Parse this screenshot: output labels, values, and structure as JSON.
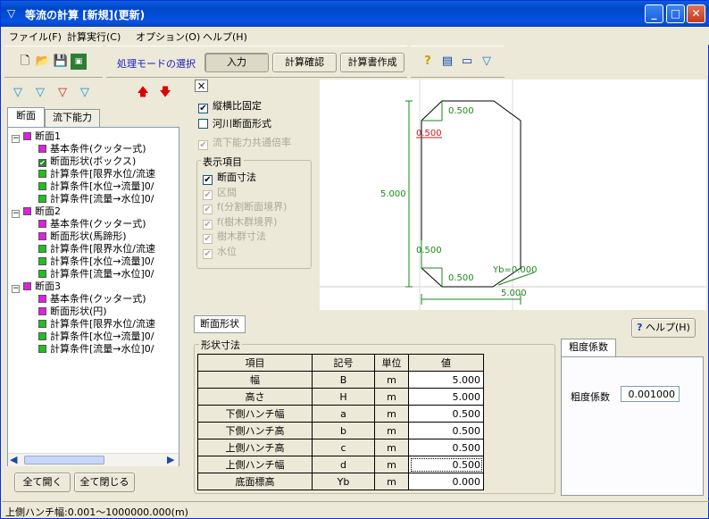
{
  "title": "等流の計算 [新規](更新)",
  "menu": [
    "ファイル(F)",
    "計算実行(C)",
    "オプション(O)",
    "ヘルプ(H)"
  ],
  "toolbar": {
    "mode_label": "処理モードの選択",
    "input": "入力",
    "confirm": "計算確認",
    "report": "計算書作成"
  },
  "left_tabs": [
    "断面",
    "流下能力"
  ],
  "tree": [
    {
      "label": "断面1",
      "children": [
        {
          "label": "基本条件(クッター式)",
          "color": "#e020e0"
        },
        {
          "label": "断面形状(ボックス)",
          "color": "#2a8a2a",
          "checked": true
        },
        {
          "label": "計算条件[限界水位/流速",
          "color": "#20c020"
        },
        {
          "label": "計算条件[水位→流量]0/",
          "color": "#20c020"
        },
        {
          "label": "計算条件[流量→水位]0/",
          "color": "#20c020"
        }
      ]
    },
    {
      "label": "断面2",
      "children": [
        {
          "label": "基本条件(クッター式)",
          "color": "#e020e0"
        },
        {
          "label": "断面形状(馬蹄形)",
          "color": "#e020e0"
        },
        {
          "label": "計算条件[限界水位/流速",
          "color": "#20c020"
        },
        {
          "label": "計算条件[水位→流量]0/",
          "color": "#20c020"
        },
        {
          "label": "計算条件[流量→水位]0/",
          "color": "#20c020"
        }
      ]
    },
    {
      "label": "断面3",
      "children": [
        {
          "label": "基本条件(クッター式)",
          "color": "#e020e0"
        },
        {
          "label": "断面形状(円)",
          "color": "#e020e0"
        },
        {
          "label": "計算条件[限界水位/流速",
          "color": "#20c020"
        },
        {
          "label": "計算条件[水位→流量]0/",
          "color": "#20c020"
        },
        {
          "label": "計算条件[流量→水位]0/",
          "color": "#20c020"
        }
      ]
    }
  ],
  "expand_all": "全て開く",
  "collapse_all": "全て閉じる",
  "options": {
    "close": "×",
    "fixed_ratio": "縦横比固定",
    "river_section": "河川断面形式",
    "shared_rate": "流下能力共通倍率",
    "display_group": "表示項目",
    "items": [
      {
        "label": "断面寸法",
        "checked": true,
        "enabled": true
      },
      {
        "label": "区間",
        "checked": true,
        "enabled": false
      },
      {
        "label": "f(分割断面境界)",
        "checked": true,
        "enabled": false
      },
      {
        "label": "f(樹木群境界)",
        "checked": true,
        "enabled": false
      },
      {
        "label": "樹木群寸法",
        "checked": true,
        "enabled": false
      },
      {
        "label": "水位",
        "checked": true,
        "enabled": false
      }
    ]
  },
  "drawing": {
    "dim_top": "0.500",
    "dim_topleft": "0.500",
    "dim_height": "5.000",
    "dim_bl_a": "0.500",
    "dim_bl_b": "0.500",
    "yb": "Yb=0.000",
    "dim_width": "5.000"
  },
  "bottom_tab": "断面形状",
  "help": "ヘルプ(H)",
  "group_shape": "形状寸法",
  "table": {
    "headers": [
      "項目",
      "記号",
      "単位",
      "値"
    ],
    "rows": [
      [
        "幅",
        "B",
        "m",
        "5.000"
      ],
      [
        "高さ",
        "H",
        "m",
        "5.000"
      ],
      [
        "下側ハンチ幅",
        "a",
        "m",
        "0.500"
      ],
      [
        "下側ハンチ高",
        "b",
        "m",
        "0.500"
      ],
      [
        "上側ハンチ高",
        "c",
        "m",
        "0.500"
      ],
      [
        "上側ハンチ幅",
        "d",
        "m",
        "0.500"
      ],
      [
        "底面標高",
        "Yb",
        "m",
        "0.000"
      ]
    ]
  },
  "roughness": {
    "tab": "粗度係数",
    "label": "粗度係数",
    "value": "0.001000"
  },
  "status": "上側ハンチ幅:0.001～1000000.000(m)"
}
